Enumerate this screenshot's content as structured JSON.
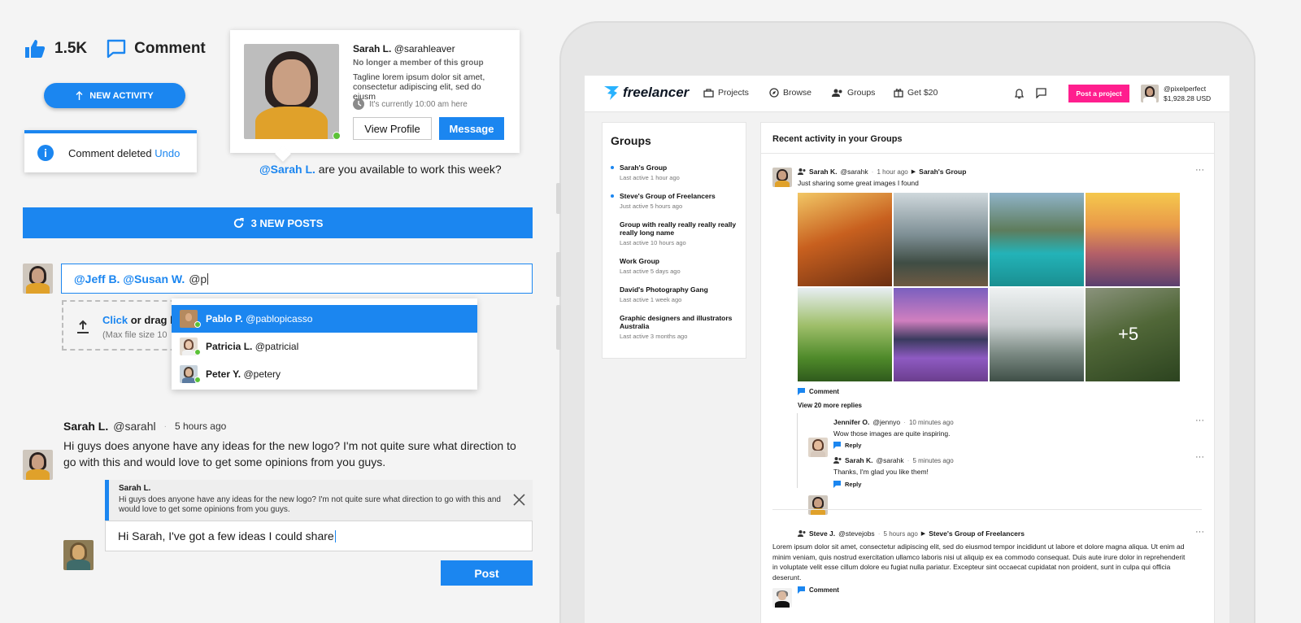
{
  "reactions": {
    "likes": "1.5K",
    "comment_label": "Comment"
  },
  "new_activity_label": "NEW ACTIVITY",
  "toast": {
    "message": "Comment deleted",
    "action": "Undo"
  },
  "profile_card": {
    "name": "Sarah L.",
    "handle": "@sarahleaver",
    "status": "No longer a member of this group",
    "tagline": "Tagline lorem ipsum dolor sit amet, consectetur adipiscing elit, sed do eiusm",
    "local_time": "It's currently 10:00 am here",
    "view_profile": "View Profile",
    "message": "Message"
  },
  "mention_prompt": {
    "mention": "@Sarah L.",
    "text": "are you available to work this week?"
  },
  "new_posts_label": "3 NEW POSTS",
  "composer": {
    "mentions": "@Jeff B. @Susan W.",
    "typed": "@p"
  },
  "upload": {
    "click": "Click",
    "rest": "or drag h",
    "hint": "(Max file size 10"
  },
  "suggestions": [
    {
      "name": "Pablo P.",
      "handle": "@pablopicasso"
    },
    {
      "name": "Patricia L.",
      "handle": "@patricial"
    },
    {
      "name": "Peter Y.",
      "handle": "@petery"
    }
  ],
  "comment": {
    "name": "Sarah L.",
    "handle": "@sarahl",
    "sep": "·",
    "time": "5 hours ago",
    "text": "Hi guys does anyone have any ideas for the new logo? I'm not quite sure what direction to go with this and would love to get some opinions from you guys."
  },
  "reply": {
    "quote_name": "Sarah L.",
    "quote_text": "Hi guys does anyone have any ideas for the new logo? I'm not quite sure what direction to go with this and would love to get some opinions from you guys.",
    "input_value": "Hi Sarah, I've got a few ideas I could share",
    "post_label": "Post"
  },
  "app": {
    "logo": "freelancer",
    "nav": [
      "Projects",
      "Browse",
      "Groups",
      "Get $20"
    ],
    "post_project": "Post a project",
    "user": {
      "handle": "@pixelperfect",
      "balance": "$1,928.28 USD"
    },
    "groups_title": "Groups",
    "groups": [
      {
        "name": "Sarah's Group",
        "sub": "Last active 1 hour ago"
      },
      {
        "name": "Steve's Group of Freelancers",
        "sub": "Just active 5 hours ago"
      },
      {
        "name": "Group with really really really really really long name",
        "sub": "Last active 10 hours ago"
      },
      {
        "name": "Work Group",
        "sub": "Last active 5 days ago"
      },
      {
        "name": "David's Photography Gang",
        "sub": "Last active 1 week ago"
      },
      {
        "name": "Graphic designers and illustrators Australia",
        "sub": "Last active 3 months ago"
      }
    ],
    "feed_title": "Recent activity in your Groups",
    "post1": {
      "name": "Sarah K.",
      "handle": "@sarahk",
      "time": "1 hour ago",
      "group": "Sarah's Group",
      "text": "Just sharing some great images I found",
      "more": "+5",
      "comment": "Comment",
      "view_more": "View 20 more replies"
    },
    "reply1": {
      "name": "Jennifer O.",
      "handle": "@jennyo",
      "time": "10 minutes ago",
      "text": "Wow those images are quite inspiring.",
      "reply": "Reply"
    },
    "reply2": {
      "name": "Sarah K.",
      "handle": "@sarahk",
      "time": "5 minutes ago",
      "text": "Thanks, I'm glad you like them!",
      "reply": "Reply"
    },
    "post2": {
      "name": "Steve J.",
      "handle": "@stevejobs",
      "time": "5 hours ago",
      "group": "Steve's Group of Freelancers",
      "text": "Lorem ipsum dolor sit amet, consectetur adipiscing elit, sed do eiusmod tempor incididunt ut labore et dolore magna aliqua. Ut enim ad minim veniam, quis nostrud exercitation ullamco laboris nisi ut aliquip ex ea commodo consequat. Duis aute irure dolor in reprehenderit in voluptate velit esse cillum dolore eu fugiat nulla pariatur. Excepteur sint occaecat cupidatat non proident, sunt in culpa qui officia deserunt.",
      "comment": "Comment"
    }
  },
  "colors": {
    "accent": "#1b86f0",
    "pink": "#ff1e8e",
    "online": "#5bc237"
  }
}
